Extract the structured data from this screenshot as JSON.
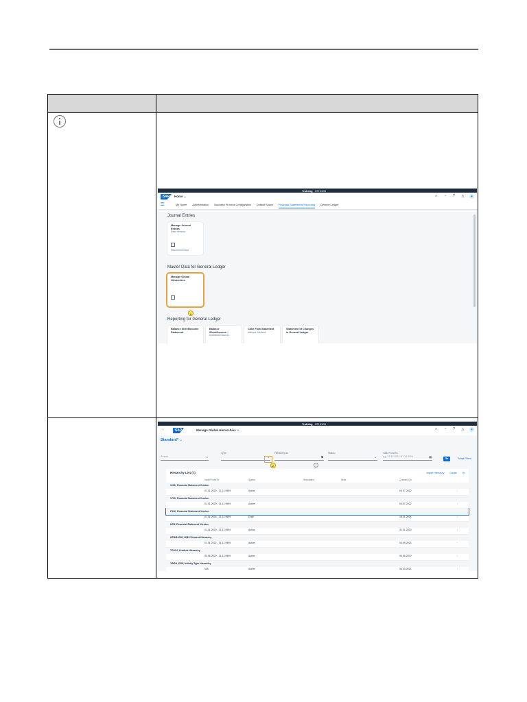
{
  "screenshot1": {
    "system": "Training",
    "client": "GTH/100",
    "home_title": "Home",
    "tabs": [
      "My Home",
      "Administration",
      "Business Process Configuration",
      "Default Space",
      "Financial Statements Reporting",
      "General Ledger"
    ],
    "active_tab": "Financial Statements Reporting",
    "sections": {
      "journal": "Journal Entries",
      "master": "Master Data for General Ledger",
      "reporting": "Reporting for General Ledger"
    },
    "tiles": {
      "manage_journal": {
        "title": "Manage Journal Entries",
        "subtitle": "New Version",
        "footer": "Recommended"
      },
      "manage_hierarchies": {
        "title": "Manage Global Hierarchies"
      },
      "balance_sheet": {
        "title": "Balance Sheet/Income Statement"
      },
      "balance_sheet_multi": {
        "title": "Balance Sheet/Income...",
        "subtitle": "Multidimensional"
      },
      "cash_flow": {
        "title": "Cash Flow Statement",
        "subtitle": "Indirect Method"
      },
      "changes_gl": {
        "title": "Statement of Changes in General Ledger"
      }
    },
    "step_marker": "1"
  },
  "screenshot2": {
    "system": "Training",
    "client": "GTH/100",
    "app_title": "Manage Global Hierarchies",
    "variant": "Standard*",
    "filters": {
      "search_placeholder": "Search",
      "type_label": "Type:",
      "hierarchy_id_label": "Hierarchy ID:",
      "status_label": "Status:",
      "valid_from_label": "Valid From/To:",
      "valid_placeholder": "e.g. 22.12.2024–31.12.2024",
      "go_label": "Go",
      "adapt_label": "Adapt Filters"
    },
    "step_marker": "2",
    "list": {
      "title": "Hierarchy List (7)",
      "import_label": "Import Hierarchy",
      "create_label": "Create",
      "columns": [
        "Valid From/To",
        "Status",
        "Simulated",
        "Note",
        "Created On"
      ],
      "groups": [
        {
          "name": "1020, Financial Statement Version",
          "valid": "01.01.2020 - 31.12.9999",
          "status": "Active",
          "created": "04.07.2022"
        },
        {
          "name": "1730, Financial Statement Version",
          "valid": "01.01.2020 - 31.12.9999",
          "status": "Active",
          "created": "04.07.2022"
        },
        {
          "name": "F100, Financial Statement Version",
          "valid": "01.01.2024 - 31.12.9999",
          "status": "Draft",
          "created": "18.01.2024"
        },
        {
          "name": "HFB, Financial Statement Version",
          "valid": "01.01.2020 - 31.12.9999",
          "status": "Active",
          "created": "31.01.2020"
        },
        {
          "name": "HFB/B1000, WBS Element Hierarchy",
          "valid": "01.01.2022 - 31.12.9999",
          "status": "Active",
          "created": "04.09.2023"
        },
        {
          "name": "TGVL0, Product Hierarchy",
          "valid": "04.06.2020 - 31.12.9999",
          "status": "Active",
          "created": "04.06.2020"
        },
        {
          "name": "YBGH_PR8, Activity Type Hierarchy",
          "valid": "N/A",
          "status": "Active",
          "created": "04.03.2021"
        }
      ]
    }
  }
}
